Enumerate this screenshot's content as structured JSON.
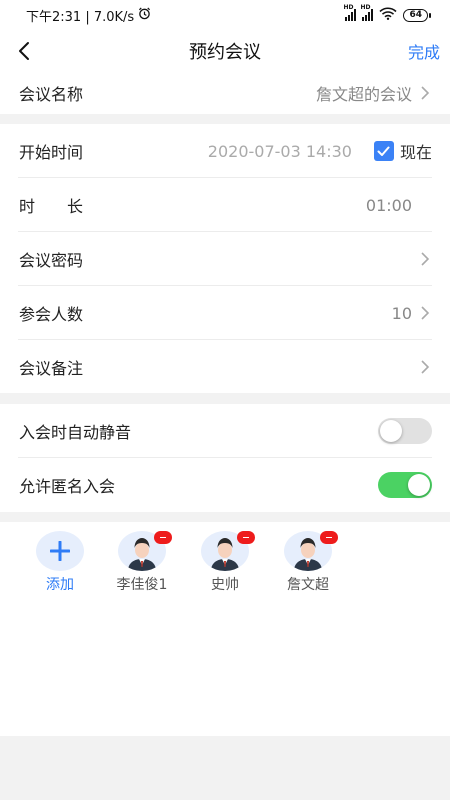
{
  "status_bar": {
    "time_speed": "下午2:31 | 7.0K/s",
    "signal1_label": "HD",
    "signal2_label": "HD",
    "battery": "64"
  },
  "nav": {
    "title": "预约会议",
    "done_label": "完成"
  },
  "meeting_name": {
    "label": "会议名称",
    "value": "詹文超的会议"
  },
  "start_time": {
    "label": "开始时间",
    "value": "2020-07-03 14:30",
    "now_label": "现在",
    "now_checked": true
  },
  "duration": {
    "label": "时　　长",
    "value": "01:00"
  },
  "password": {
    "label": "会议密码"
  },
  "attendees_count": {
    "label": "参会人数",
    "value": "10"
  },
  "notes": {
    "label": "会议备注"
  },
  "auto_mute": {
    "label": "入会时自动静音",
    "enabled": false
  },
  "allow_anonymous": {
    "label": "允许匿名入会",
    "enabled": true
  },
  "members": {
    "add_label": "添加",
    "list": [
      {
        "name": "李佳俊1"
      },
      {
        "name": "史帅"
      },
      {
        "name": "詹文超"
      }
    ]
  },
  "colors": {
    "accent": "#2f7cf6",
    "toggle_on": "#4bd263",
    "badge": "#ee1c1c"
  }
}
